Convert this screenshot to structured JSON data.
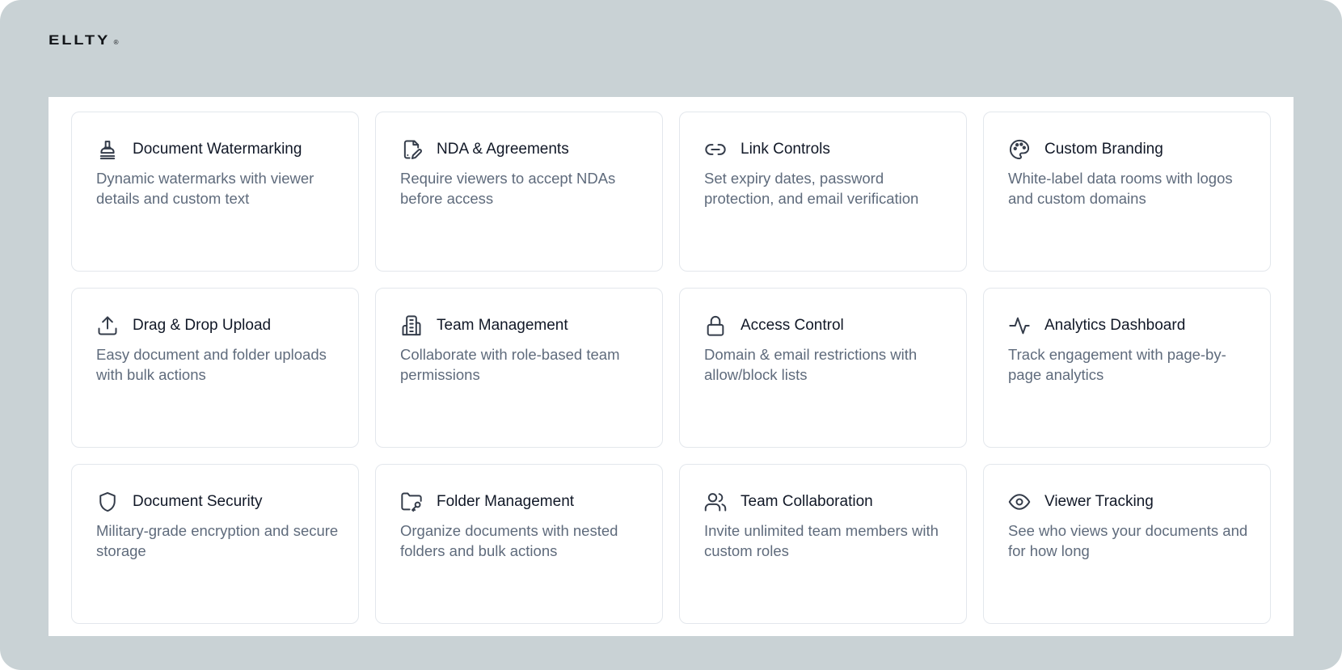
{
  "brand": {
    "name": "ELLTY",
    "mark": "®"
  },
  "colors": {
    "frame_background": "#c9d2d5",
    "panel_background": "#ffffff",
    "card_border": "#e3e7ec",
    "title_text": "#111827",
    "description_text": "#5f6b7c",
    "icon_stroke": "#343c4a"
  },
  "features": [
    {
      "icon": "stamp-icon",
      "title": "Document Watermarking",
      "description": "Dynamic watermarks with viewer details and custom text"
    },
    {
      "icon": "file-signature-icon",
      "title": "NDA & Agreements",
      "description": "Require viewers to accept NDAs before access"
    },
    {
      "icon": "link-icon",
      "title": "Link Controls",
      "description": "Set expiry dates, password protection, and email verification"
    },
    {
      "icon": "palette-icon",
      "title": "Custom Branding",
      "description": "White-label data rooms with logos and custom domains"
    },
    {
      "icon": "upload-icon",
      "title": "Drag & Drop Upload",
      "description": "Easy document and folder uploads with bulk actions"
    },
    {
      "icon": "building-icon",
      "title": "Team Management",
      "description": "Collaborate with role-based team permissions"
    },
    {
      "icon": "lock-icon",
      "title": "Access Control",
      "description": "Domain & email restrictions with allow/block lists"
    },
    {
      "icon": "activity-icon",
      "title": "Analytics Dashboard",
      "description": "Track engagement with page-by-page analytics"
    },
    {
      "icon": "shield-icon",
      "title": "Document Security",
      "description": "Military-grade encryption and secure storage"
    },
    {
      "icon": "folder-key-icon",
      "title": "Folder Management",
      "description": "Organize documents with nested folders and bulk actions"
    },
    {
      "icon": "users-icon",
      "title": "Team Collaboration",
      "description": "Invite unlimited team members with custom roles"
    },
    {
      "icon": "eye-icon",
      "title": "Viewer Tracking",
      "description": "See who views your documents and for how long"
    }
  ]
}
